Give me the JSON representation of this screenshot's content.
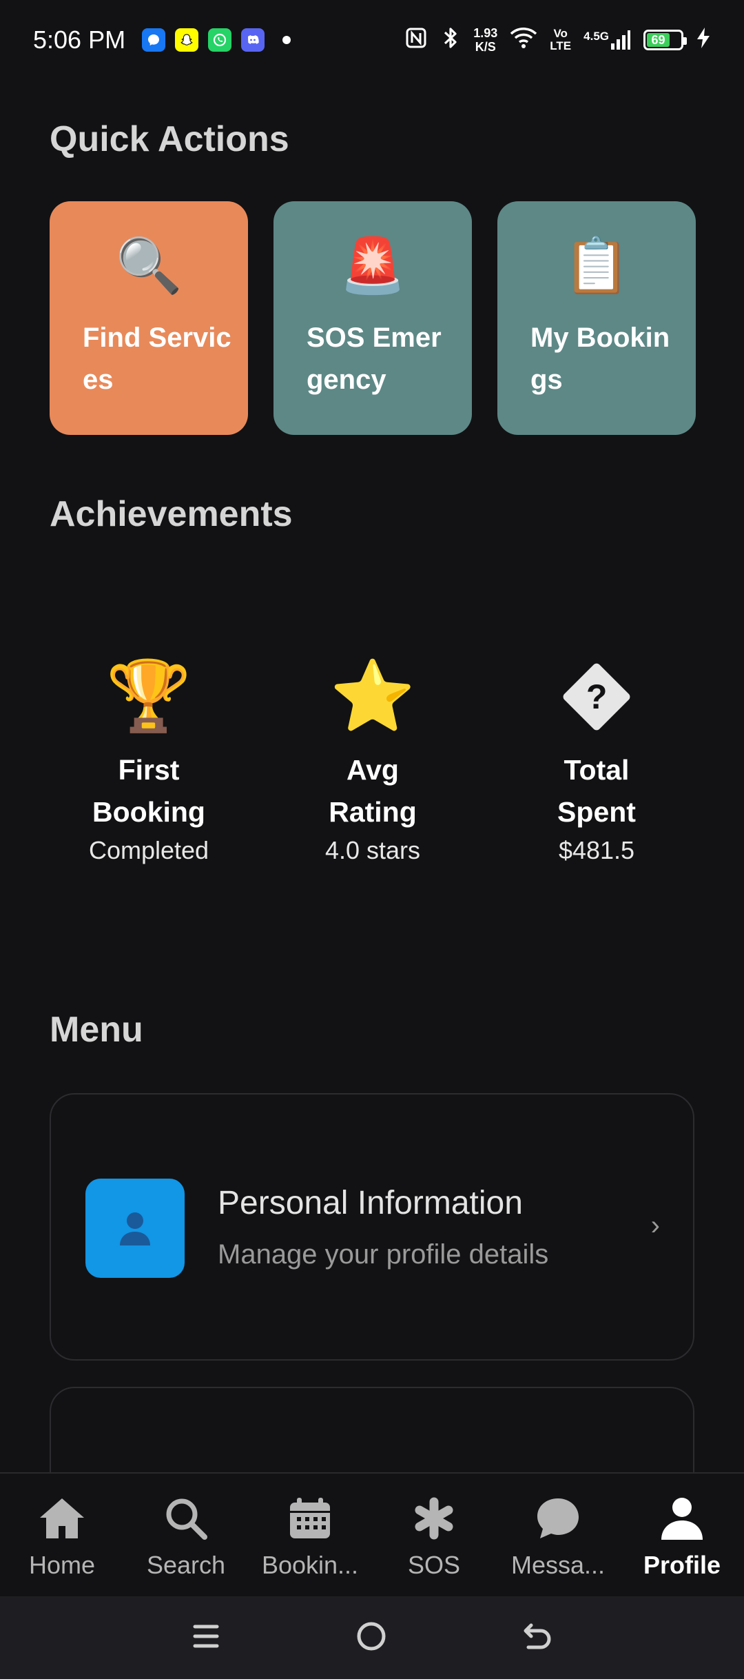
{
  "status_bar": {
    "time": "5:06 PM",
    "net_speed_value": "1.93",
    "net_speed_unit": "K/S",
    "volte_top": "Vo",
    "volte_bottom": "LTE",
    "network_type": "4.5G",
    "battery_level": "69",
    "battery_fraction": 0.69,
    "colors": {
      "battery": "#3ccf5a"
    }
  },
  "quick_actions": {
    "title": "Quick Actions",
    "items": [
      {
        "emoji": "🔍",
        "label": "Find Services",
        "color": "#e8895a"
      },
      {
        "emoji": "🚨",
        "label": "SOS Emergency",
        "color": "#5d8886"
      },
      {
        "emoji": "📋",
        "label": "My Bookings",
        "color": "#5d8886"
      }
    ]
  },
  "achievements": {
    "title": "Achievements",
    "items": [
      {
        "icon": "🏆",
        "title": "First Booking",
        "value": "Completed"
      },
      {
        "icon": "⭐",
        "title": "Avg Rating",
        "value": "4.0 stars"
      },
      {
        "icon": "?",
        "title": "Total Spent",
        "value": "$481.5"
      }
    ]
  },
  "menu": {
    "title": "Menu",
    "items": [
      {
        "icon": "👤",
        "title": "Personal Information",
        "subtitle": "Manage your profile details",
        "chevron": "›"
      }
    ]
  },
  "tab_bar": {
    "tabs": [
      {
        "label": "Home",
        "icon": "home-icon"
      },
      {
        "label": "Search",
        "icon": "search-icon"
      },
      {
        "label": "Bookin...",
        "icon": "calendar-icon"
      },
      {
        "label": "SOS",
        "icon": "asterisk-icon"
      },
      {
        "label": "Messa...",
        "icon": "chat-icon"
      },
      {
        "label": "Profile",
        "icon": "person-icon",
        "active": true
      }
    ]
  }
}
